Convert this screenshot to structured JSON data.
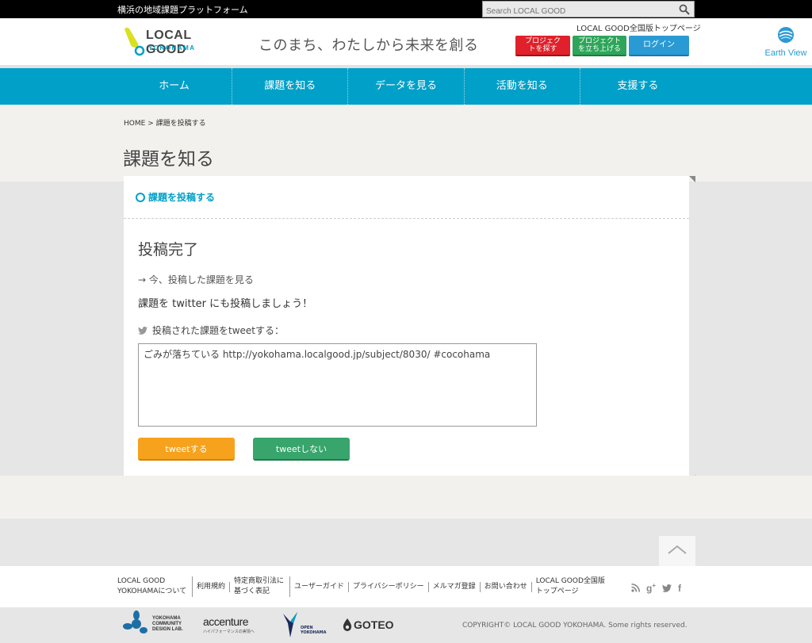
{
  "topbar": {
    "tagline": "横浜の地域課題プラットフォーム",
    "search_placeholder": "Search LOCAL GOOD"
  },
  "header": {
    "logo_main": "LOCAL GOOD",
    "logo_sub": "YOKOHAMA",
    "slogan": "このまち、わたしから未来を創る",
    "top_link": "LOCAL GOOD全国版トップページ",
    "find_project": "プロジェクトを探す",
    "start_project": "プロジェクトを立ち上げる",
    "login": "ログイン",
    "earth_view": "Earth View"
  },
  "nav": {
    "items": [
      "ホーム",
      "課題を知る",
      "データを見る",
      "活動を知る",
      "支援する"
    ]
  },
  "breadcrumb": {
    "home": "HOME",
    "current": "課題を投稿する"
  },
  "page": {
    "title": "課題を知る",
    "section": "課題を投稿する",
    "done": "投稿完了",
    "view_link": "→ 今、投稿した課題を見る",
    "twitter_prompt": "課題を twitter にも投稿しましょう！",
    "tweet_label": "投稿された課題をtweetする：",
    "tweet_text": "ごみが落ちている http://yokohama.localgood.jp/subject/8030/ #cocohama",
    "tweet_button": "tweetする",
    "no_tweet_button": "tweetしない"
  },
  "footer": {
    "links": [
      "LOCAL GOOD YOKOHAMAについて",
      "利用規約",
      "特定商取引法に基づく表記",
      "ユーザーガイド",
      "プライバシーポリシー",
      "メルマガ登録",
      "お問い合わせ",
      "LOCAL GOOD全国版トップページ"
    ],
    "partners": {
      "yokohama_cdl": "YOKOHAMA COMMUNITY DESIGN LAB.",
      "accenture": "accenture",
      "accenture_sub": "ハイパフォーマンスの実現へ",
      "open_yokohama_1": "OPEN",
      "open_yokohama_2": "YOKOHAMA",
      "goteo": "GOTEO"
    },
    "copyright": "COPYRIGHT© LOCAL GOOD YOKOHAMA. Some rights reserved."
  },
  "colors": {
    "accent": "#00a0c8",
    "find_button": "#e0202a",
    "start_button": "#2ea55a",
    "login_button": "#2a9ad4",
    "tweet_button": "#f6a21d",
    "no_tweet_button": "#37a56c"
  }
}
